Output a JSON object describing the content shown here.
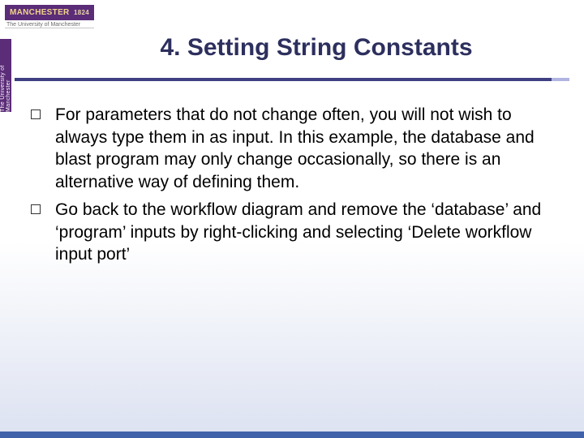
{
  "logo": {
    "name": "MANCHESTER",
    "year": "1824",
    "subtext": "The University of Manchester"
  },
  "side_tab": "The University of Manchester",
  "title": "4. Setting String Constants",
  "bullets": [
    "For parameters that do not change often, you will not wish to always type them in as input. In this example, the database and blast program may only change occasionally, so there is an alternative way of defining them.",
    "Go back to the workflow diagram and remove the ‘database’ and ‘program’ inputs by right-clicking and selecting ‘Delete workflow input port’"
  ]
}
